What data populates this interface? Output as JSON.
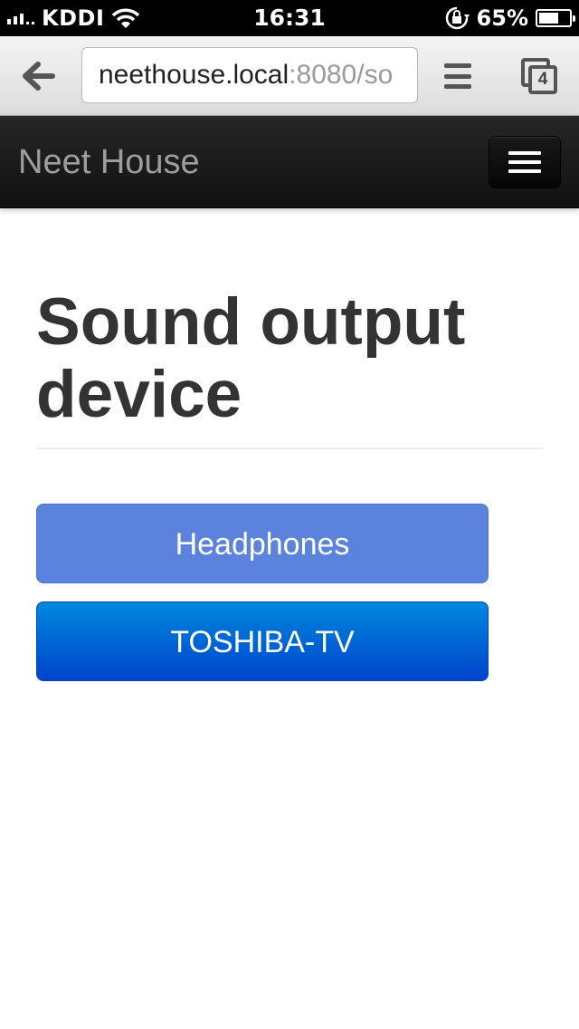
{
  "status_bar": {
    "carrier": "KDDI",
    "time": "16:31",
    "battery_percent": "65%",
    "battery_level": 0.65
  },
  "browser": {
    "url_host": "neethouse.local",
    "url_rest": ":8080/so",
    "tab_count": "4",
    "icons": [
      "back-arrow-icon",
      "menu-icon",
      "tabs-icon"
    ]
  },
  "navbar": {
    "brand": "Neet House"
  },
  "main": {
    "title": "Sound output device",
    "devices": [
      {
        "label": "Headphones",
        "color": "#5b82dd"
      },
      {
        "label": "TOSHIBA-TV",
        "color": "#0066d6"
      }
    ]
  }
}
